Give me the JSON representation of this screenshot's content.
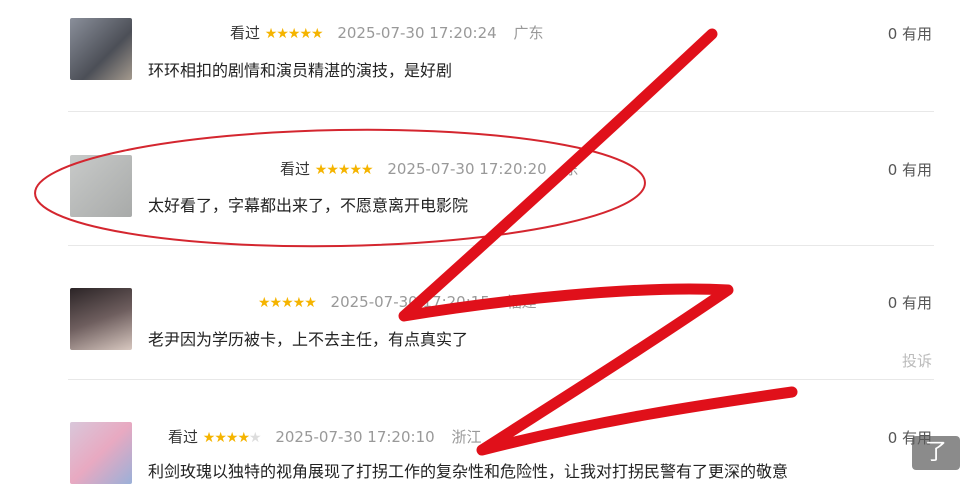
{
  "reviews": [
    {
      "name": "看过",
      "stars": 5,
      "time": "2025-07-30 17:20:24",
      "location": "广东",
      "content": "环环相扣的剧情和演员精湛的演技，是好剧",
      "useful": "0 有用",
      "avatar_color": "#6b6f7a"
    },
    {
      "name": "看过",
      "stars": 5,
      "time": "2025-07-30 17:20:20",
      "location": "东",
      "content": "太好看了，字幕都出来了，不愿意离开电影院",
      "useful": "0 有用",
      "avatar_color": "#b8bab9"
    },
    {
      "name": "",
      "stars": 5,
      "time": "2025-07-30 17:20:15",
      "location": "福建",
      "content": "老尹因为学历被卡，上不去主任，有点真实了",
      "useful": "0 有用",
      "report": "投诉",
      "avatar_color": "#3b3436"
    },
    {
      "name": "看过",
      "stars": 4,
      "time": "2025-07-30 17:20:10",
      "location": "浙江",
      "content": "利剑玫瑰以独特的视角展现了打拐工作的复杂性和危险性，让我对打拐民警有了更深的敬意",
      "useful": "0 有用",
      "avatar_color": "#c9b3c9"
    }
  ],
  "more_button": "了",
  "colors": {
    "star": "#f5b400",
    "ink": "#e0101a"
  }
}
